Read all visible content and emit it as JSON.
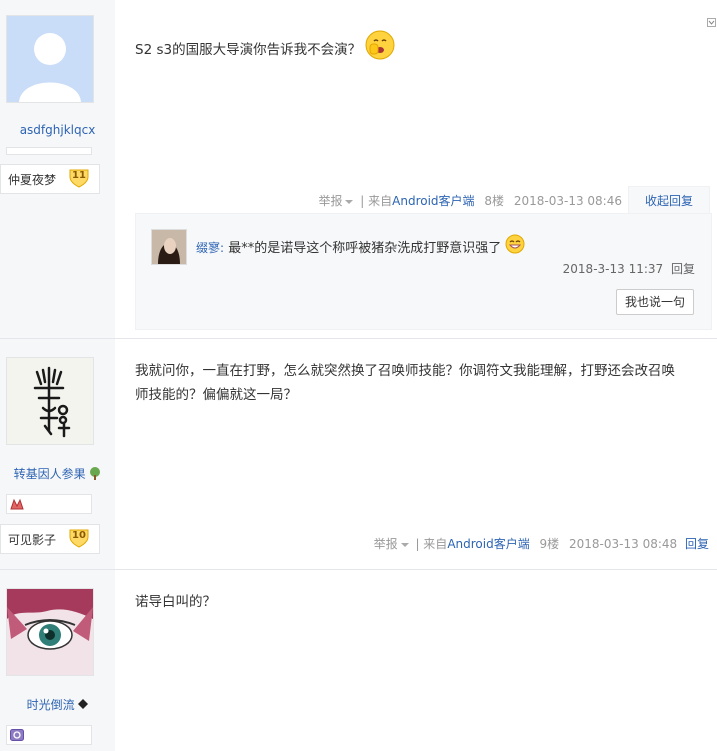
{
  "posts": [
    {
      "username": "asdfghjklqcx",
      "level_name": "仲夏夜梦",
      "level": "11",
      "text": "S2 s3的国服大导演你告诉我不会演？",
      "report": "举报",
      "source_prefix": "| 来自",
      "source": "Android客户端",
      "floor": "8楼",
      "time": "2018-03-13 08:46",
      "action": "收起回复",
      "reply": {
        "user": "缀寥:",
        "text": "最**的是诺导这个称呼被猪杂洗成打野意识强了",
        "time": "2018-3-13 11:37",
        "action": "回复",
        "say_button": "我也说一句"
      }
    },
    {
      "username": "转基因人参果",
      "level_name": "可见影子",
      "level": "10",
      "text_lines": [
        "我就问你，一直在打野，怎么就突然换了召唤师技能？你调符文我能理解，打野还会改召唤",
        "师技能的？偏偏就这一局？"
      ],
      "report": "举报",
      "source_prefix": "| 来自",
      "source": "Android客户端",
      "floor": "9楼",
      "time": "2018-03-13 08:48",
      "action": "回复"
    },
    {
      "username": "时光倒流",
      "text": "诺导白叫的？"
    }
  ],
  "colors": {
    "link": "#2d64b3",
    "sidebar": "#f6f7f9",
    "meta": "#999999"
  },
  "icons": [
    "default-avatar-icon",
    "emoji-shy-icon",
    "emoji-grin-icon",
    "level-shield-icon",
    "tree-icon",
    "diamond-icon",
    "collapse-icon"
  ]
}
